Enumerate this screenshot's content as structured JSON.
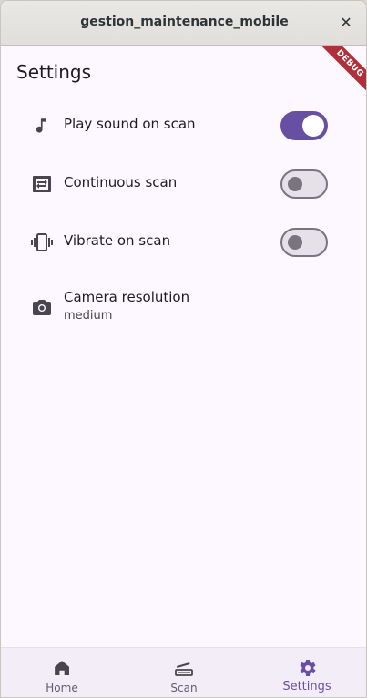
{
  "window": {
    "title": "gestion_maintenance_mobile",
    "close_label": "✕"
  },
  "debug_banner": "DEBUG",
  "page": {
    "title": "Settings"
  },
  "settings": [
    {
      "label": "Play sound on scan",
      "icon": "music-note-icon",
      "enabled": true
    },
    {
      "label": "Continuous scan",
      "icon": "repeat-icon",
      "enabled": false
    },
    {
      "label": "Vibrate on scan",
      "icon": "vibration-icon",
      "enabled": false
    }
  ],
  "camera": {
    "label": "Camera resolution",
    "value": "medium",
    "icon": "camera-icon"
  },
  "nav": {
    "items": [
      {
        "label": "Home",
        "icon": "home-icon",
        "active": false
      },
      {
        "label": "Scan",
        "icon": "scan-icon",
        "active": false
      },
      {
        "label": "Settings",
        "icon": "gear-icon",
        "active": true
      }
    ]
  },
  "colors": {
    "accent": "#6750a4",
    "background": "#fdf7ff",
    "nav_background": "#f3edf7"
  }
}
